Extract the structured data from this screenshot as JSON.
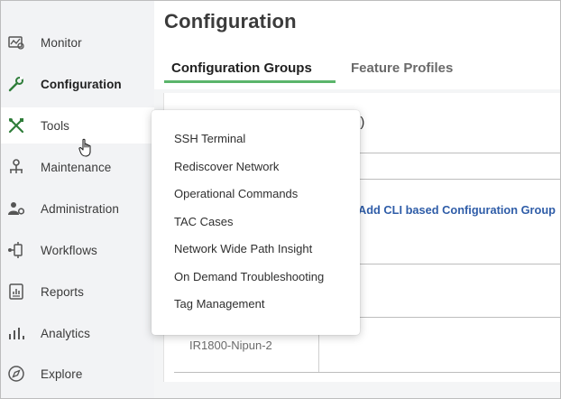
{
  "sidebar": {
    "items": [
      {
        "label": "Monitor",
        "icon": "monitor-icon"
      },
      {
        "label": "Configuration",
        "icon": "configuration-icon"
      },
      {
        "label": "Tools",
        "icon": "tools-icon"
      },
      {
        "label": "Maintenance",
        "icon": "maintenance-icon"
      },
      {
        "label": "Administration",
        "icon": "administration-icon"
      },
      {
        "label": "Workflows",
        "icon": "workflows-icon"
      },
      {
        "label": "Reports",
        "icon": "reports-icon"
      },
      {
        "label": "Analytics",
        "icon": "analytics-icon"
      },
      {
        "label": "Explore",
        "icon": "explore-icon"
      }
    ]
  },
  "header": {
    "title": "Configuration"
  },
  "tabs": [
    {
      "label": "Configuration Groups",
      "active": true
    },
    {
      "label": "Feature Profiles",
      "active": false
    }
  ],
  "content": {
    "count_text": "1)",
    "add_link": "Add CLI based Configuration Group",
    "row_device": "IR1800-Nipun-2"
  },
  "tools_menu": {
    "items": [
      "SSH Terminal",
      "Rediscover Network",
      "Operational Commands",
      "TAC Cases",
      "Network Wide Path Insight",
      "On Demand Troubleshooting",
      "Tag Management"
    ]
  },
  "colors": {
    "accent_green": "#5bb56b",
    "link_blue": "#2f5da8",
    "sidebar_bg": "#f2f3f5"
  }
}
